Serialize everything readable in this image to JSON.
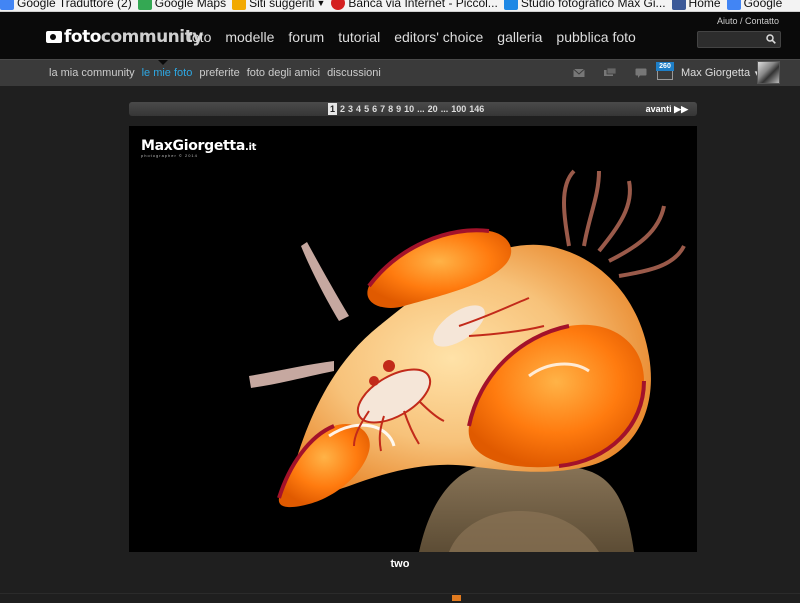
{
  "bookmarks": [
    {
      "label": "Google Traduttore (2)",
      "color": "#4285f4"
    },
    {
      "label": "Google Maps",
      "color": "#34a853"
    },
    {
      "label": "Siti suggeriti",
      "color": "#f2a900"
    },
    {
      "label": "Banca via Internet - Piccol...",
      "color": "#d42020"
    },
    {
      "label": "Studio fotografico Max Gi...",
      "color": "#1e88e5"
    },
    {
      "label": "Home",
      "color": "#3b5998"
    },
    {
      "label": "Google",
      "color": "#4285f4"
    }
  ],
  "header": {
    "logo_part1": "foto",
    "logo_part2": "community",
    "nav": [
      "foto",
      "modelle",
      "forum",
      "tutorial",
      "editors' choice",
      "galleria",
      "pubblica foto"
    ],
    "help": "Aiuto / Contatto"
  },
  "subnav": {
    "items": [
      "la mia community",
      "le mie foto",
      "preferite",
      "foto degli amici",
      "discussioni"
    ],
    "active_index": 1,
    "notifications": "260",
    "username": "Max Giorgetta"
  },
  "pagination": {
    "pages": [
      "1",
      "2",
      "3",
      "4",
      "5",
      "6",
      "7",
      "8",
      "9",
      "10",
      "...",
      "20",
      "...",
      "100",
      "146"
    ],
    "current": "1",
    "next_label": "avanti"
  },
  "photo": {
    "watermark": "MaxGiorgetta",
    "watermark_tld": ".it",
    "watermark_sub": "photographer © 2014",
    "caption": "two"
  },
  "colors": {
    "accent": "#2ea8e4",
    "header_bg": "#0a0a0a",
    "subbar_bg": "#3a3a3a",
    "page_bg": "#1f1f1f"
  }
}
